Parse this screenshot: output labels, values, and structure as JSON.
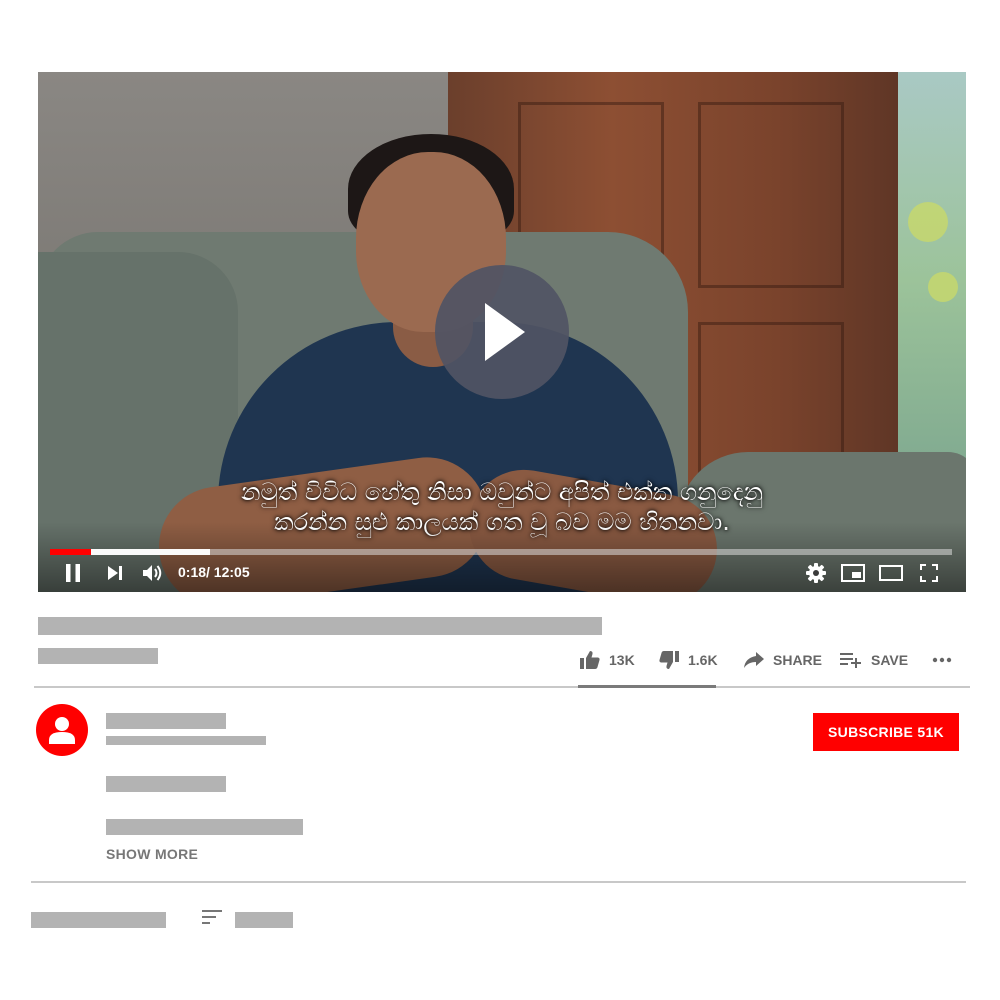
{
  "player": {
    "subtitle_lines": [
      "නමුත් විවිධ හේතු නිසා ඔවුන්ට අපිත් එක්ක ගනුදෙනු",
      "කරන්න සුළු කාලයක් ගත වූ බව මම හිතනවා."
    ],
    "current_time": "0:18",
    "duration": "/ 12:05",
    "played_fraction": 0.045,
    "buffered_fraction": 0.177,
    "icons": [
      "play-icon",
      "pause-icon",
      "next-icon",
      "volume-icon",
      "settings-icon",
      "miniplayer-icon",
      "theater-icon",
      "fullscreen-icon"
    ]
  },
  "actions": {
    "likes": "13K",
    "dislikes": "1.6K",
    "share_label": "SHARE",
    "save_label": "SAVE"
  },
  "channel": {
    "subscribe_label": "SUBSCRIBE 51K",
    "show_more_label": "SHOW MORE"
  },
  "colors": {
    "brand_red": "#ff0000",
    "placeholder_gray": "#b3b3b3"
  }
}
